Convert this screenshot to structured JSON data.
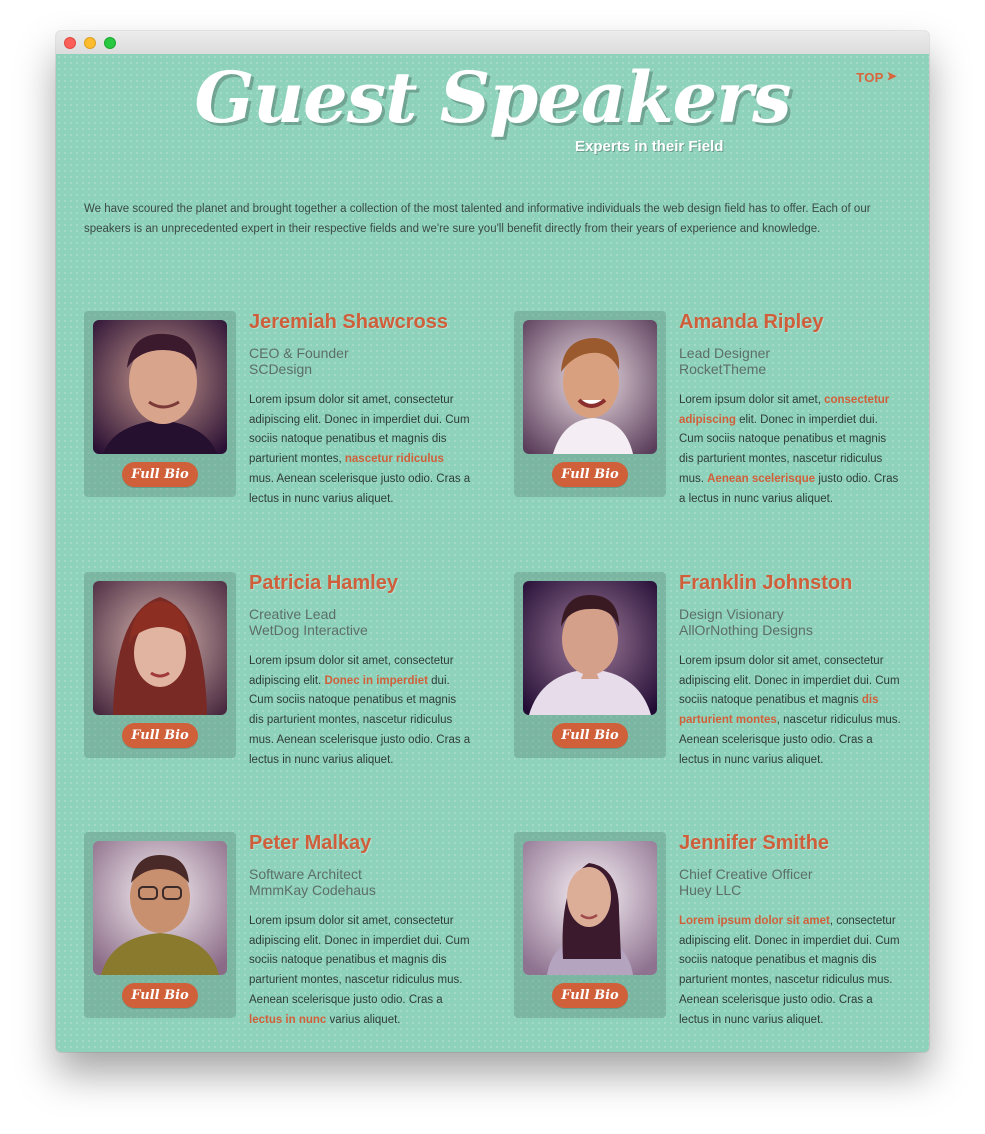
{
  "header": {
    "title": "Guest Speakers",
    "subtitle": "Experts in their Field",
    "top_link": "TOP"
  },
  "intro": "We have scoured the planet and brought together a collection of the most talented and informative individuals the web design field has to offer. Each of our speakers is an unprecedented expert in their respective fields and we're sure you'll benefit directly from their years of experience and knowledge.",
  "button_label": "Full Bio",
  "speakers": [
    {
      "name": "Jeremiah Shawcross",
      "title": "CEO & Founder",
      "company": "SCDesign",
      "bio_before": "Lorem ipsum dolor sit amet, consectetur adipiscing elit. Donec in imperdiet dui. Cum sociis natoque penatibus et magnis dis parturient montes, ",
      "bio_highlight": "nascetur ridiculus",
      "bio_after": " mus. Aenean scelerisque justo odio. Cras a lectus in nunc varius aliquet."
    },
    {
      "name": "Amanda Ripley",
      "title": "Lead Designer",
      "company": "RocketTheme",
      "bio_before": "Lorem ipsum dolor sit amet, ",
      "bio_highlight": "consectetur adipiscing",
      "bio_mid": " elit. Donec in imperdiet dui. Cum sociis natoque penatibus et magnis dis parturient montes, nascetur ridiculus mus. ",
      "bio_highlight2": "Aenean scelerisque",
      "bio_after": " justo odio. Cras a lectus in nunc varius aliquet."
    },
    {
      "name": "Patricia Hamley",
      "title": "Creative Lead",
      "company": "WetDog Interactive",
      "bio_before": "Lorem ipsum dolor sit amet, consectetur adipiscing elit. ",
      "bio_highlight": "Donec in imperdiet",
      "bio_after": " dui. Cum sociis natoque penatibus et magnis dis parturient montes, nascetur ridiculus mus. Aenean scelerisque justo odio. Cras a lectus in nunc varius aliquet."
    },
    {
      "name": "Franklin Johnston",
      "title": "Design Visionary",
      "company": "AllOrNothing Designs",
      "bio_before": "Lorem ipsum dolor sit amet, consectetur adipiscing elit. Donec in imperdiet dui. Cum sociis natoque penatibus et magnis ",
      "bio_highlight": "dis parturient montes",
      "bio_after": ", nascetur ridiculus mus. Aenean scelerisque justo odio. Cras a lectus in nunc varius aliquet."
    },
    {
      "name": "Peter Malkay",
      "title": "Software Architect",
      "company": "MmmKay Codehaus",
      "bio_before": "Lorem ipsum dolor sit amet, consectetur adipiscing elit. Donec in imperdiet dui. Cum sociis natoque penatibus et magnis dis parturient montes, nascetur ridiculus mus. Aenean scelerisque justo odio. Cras a ",
      "bio_highlight": "lectus in nunc",
      "bio_after": " varius aliquet."
    },
    {
      "name": "Jennifer Smithe",
      "title": "Chief Creative Officer",
      "company": "Huey LLC",
      "bio_before": "",
      "bio_highlight": "Lorem ipsum dolor sit amet",
      "bio_after": ", consectetur adipiscing elit. Donec in imperdiet dui. Cum sociis natoque penatibus et magnis dis parturient montes, nascetur ridiculus mus. Aenean scelerisque justo odio. Cras a lectus in nunc varius aliquet."
    }
  ]
}
